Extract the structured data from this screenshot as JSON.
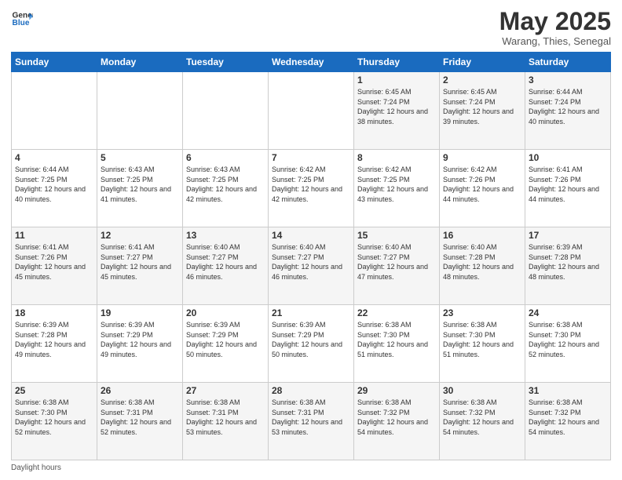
{
  "logo": {
    "line1": "General",
    "line2": "Blue"
  },
  "header": {
    "month": "May 2025",
    "location": "Warang, Thies, Senegal"
  },
  "days_of_week": [
    "Sunday",
    "Monday",
    "Tuesday",
    "Wednesday",
    "Thursday",
    "Friday",
    "Saturday"
  ],
  "weeks": [
    [
      {
        "num": "",
        "info": ""
      },
      {
        "num": "",
        "info": ""
      },
      {
        "num": "",
        "info": ""
      },
      {
        "num": "",
        "info": ""
      },
      {
        "num": "1",
        "info": "Sunrise: 6:45 AM\nSunset: 7:24 PM\nDaylight: 12 hours\nand 38 minutes."
      },
      {
        "num": "2",
        "info": "Sunrise: 6:45 AM\nSunset: 7:24 PM\nDaylight: 12 hours\nand 39 minutes."
      },
      {
        "num": "3",
        "info": "Sunrise: 6:44 AM\nSunset: 7:24 PM\nDaylight: 12 hours\nand 40 minutes."
      }
    ],
    [
      {
        "num": "4",
        "info": "Sunrise: 6:44 AM\nSunset: 7:25 PM\nDaylight: 12 hours\nand 40 minutes."
      },
      {
        "num": "5",
        "info": "Sunrise: 6:43 AM\nSunset: 7:25 PM\nDaylight: 12 hours\nand 41 minutes."
      },
      {
        "num": "6",
        "info": "Sunrise: 6:43 AM\nSunset: 7:25 PM\nDaylight: 12 hours\nand 42 minutes."
      },
      {
        "num": "7",
        "info": "Sunrise: 6:42 AM\nSunset: 7:25 PM\nDaylight: 12 hours\nand 42 minutes."
      },
      {
        "num": "8",
        "info": "Sunrise: 6:42 AM\nSunset: 7:25 PM\nDaylight: 12 hours\nand 43 minutes."
      },
      {
        "num": "9",
        "info": "Sunrise: 6:42 AM\nSunset: 7:26 PM\nDaylight: 12 hours\nand 44 minutes."
      },
      {
        "num": "10",
        "info": "Sunrise: 6:41 AM\nSunset: 7:26 PM\nDaylight: 12 hours\nand 44 minutes."
      }
    ],
    [
      {
        "num": "11",
        "info": "Sunrise: 6:41 AM\nSunset: 7:26 PM\nDaylight: 12 hours\nand 45 minutes."
      },
      {
        "num": "12",
        "info": "Sunrise: 6:41 AM\nSunset: 7:27 PM\nDaylight: 12 hours\nand 45 minutes."
      },
      {
        "num": "13",
        "info": "Sunrise: 6:40 AM\nSunset: 7:27 PM\nDaylight: 12 hours\nand 46 minutes."
      },
      {
        "num": "14",
        "info": "Sunrise: 6:40 AM\nSunset: 7:27 PM\nDaylight: 12 hours\nand 46 minutes."
      },
      {
        "num": "15",
        "info": "Sunrise: 6:40 AM\nSunset: 7:27 PM\nDaylight: 12 hours\nand 47 minutes."
      },
      {
        "num": "16",
        "info": "Sunrise: 6:40 AM\nSunset: 7:28 PM\nDaylight: 12 hours\nand 48 minutes."
      },
      {
        "num": "17",
        "info": "Sunrise: 6:39 AM\nSunset: 7:28 PM\nDaylight: 12 hours\nand 48 minutes."
      }
    ],
    [
      {
        "num": "18",
        "info": "Sunrise: 6:39 AM\nSunset: 7:28 PM\nDaylight: 12 hours\nand 49 minutes."
      },
      {
        "num": "19",
        "info": "Sunrise: 6:39 AM\nSunset: 7:29 PM\nDaylight: 12 hours\nand 49 minutes."
      },
      {
        "num": "20",
        "info": "Sunrise: 6:39 AM\nSunset: 7:29 PM\nDaylight: 12 hours\nand 50 minutes."
      },
      {
        "num": "21",
        "info": "Sunrise: 6:39 AM\nSunset: 7:29 PM\nDaylight: 12 hours\nand 50 minutes."
      },
      {
        "num": "22",
        "info": "Sunrise: 6:38 AM\nSunset: 7:30 PM\nDaylight: 12 hours\nand 51 minutes."
      },
      {
        "num": "23",
        "info": "Sunrise: 6:38 AM\nSunset: 7:30 PM\nDaylight: 12 hours\nand 51 minutes."
      },
      {
        "num": "24",
        "info": "Sunrise: 6:38 AM\nSunset: 7:30 PM\nDaylight: 12 hours\nand 52 minutes."
      }
    ],
    [
      {
        "num": "25",
        "info": "Sunrise: 6:38 AM\nSunset: 7:30 PM\nDaylight: 12 hours\nand 52 minutes."
      },
      {
        "num": "26",
        "info": "Sunrise: 6:38 AM\nSunset: 7:31 PM\nDaylight: 12 hours\nand 52 minutes."
      },
      {
        "num": "27",
        "info": "Sunrise: 6:38 AM\nSunset: 7:31 PM\nDaylight: 12 hours\nand 53 minutes."
      },
      {
        "num": "28",
        "info": "Sunrise: 6:38 AM\nSunset: 7:31 PM\nDaylight: 12 hours\nand 53 minutes."
      },
      {
        "num": "29",
        "info": "Sunrise: 6:38 AM\nSunset: 7:32 PM\nDaylight: 12 hours\nand 54 minutes."
      },
      {
        "num": "30",
        "info": "Sunrise: 6:38 AM\nSunset: 7:32 PM\nDaylight: 12 hours\nand 54 minutes."
      },
      {
        "num": "31",
        "info": "Sunrise: 6:38 AM\nSunset: 7:32 PM\nDaylight: 12 hours\nand 54 minutes."
      }
    ]
  ],
  "footer": {
    "note": "Daylight hours"
  }
}
